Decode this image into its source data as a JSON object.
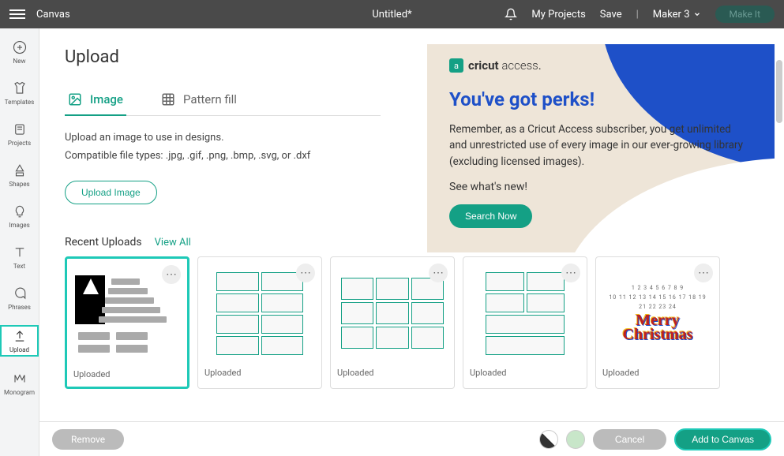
{
  "topbar": {
    "section": "Canvas",
    "title": "Untitled*",
    "my_projects": "My Projects",
    "save": "Save",
    "machine": "Maker 3",
    "make_it": "Make It"
  },
  "sidebar": {
    "items": [
      {
        "label": "New",
        "icon": "plus-circle"
      },
      {
        "label": "Templates",
        "icon": "shirt"
      },
      {
        "label": "Projects",
        "icon": "stack"
      },
      {
        "label": "Shapes",
        "icon": "shapes"
      },
      {
        "label": "Images",
        "icon": "bulb"
      },
      {
        "label": "Text",
        "icon": "text"
      },
      {
        "label": "Phrases",
        "icon": "speech"
      },
      {
        "label": "Upload",
        "icon": "upload"
      },
      {
        "label": "Monogram",
        "icon": "monogram"
      }
    ]
  },
  "page": {
    "title": "Upload",
    "tabs": {
      "image": "Image",
      "pattern": "Pattern fill"
    },
    "desc": "Upload an image to use in designs.",
    "types": "Compatible file types: .jpg, .gif, .png, .bmp, .svg, or .dxf",
    "upload_btn": "Upload Image"
  },
  "promo": {
    "brand_icon": "a",
    "brand_bold": "cricut",
    "brand_light": "access",
    "heading": "You've got perks!",
    "text": "Remember, as a Cricut Access subscriber, you get unlimited and unrestricted use of every image in our ever-growing library (excluding licensed images).",
    "sub": "See what's new!",
    "btn": "Search Now"
  },
  "recent": {
    "title": "Recent Uploads",
    "view_all": "View All",
    "card_label": "Uploaded",
    "merry_nums1": "1 2 3 4 5 6 7 8 9",
    "merry_nums2": "10 11 12 13 14 15 16 17 18 19",
    "merry_nums3": "21 22 23 24",
    "merry_line1": "Merry",
    "merry_line2": "Christmas"
  },
  "bottom": {
    "remove": "Remove",
    "cancel": "Cancel",
    "add": "Add to Canvas"
  }
}
